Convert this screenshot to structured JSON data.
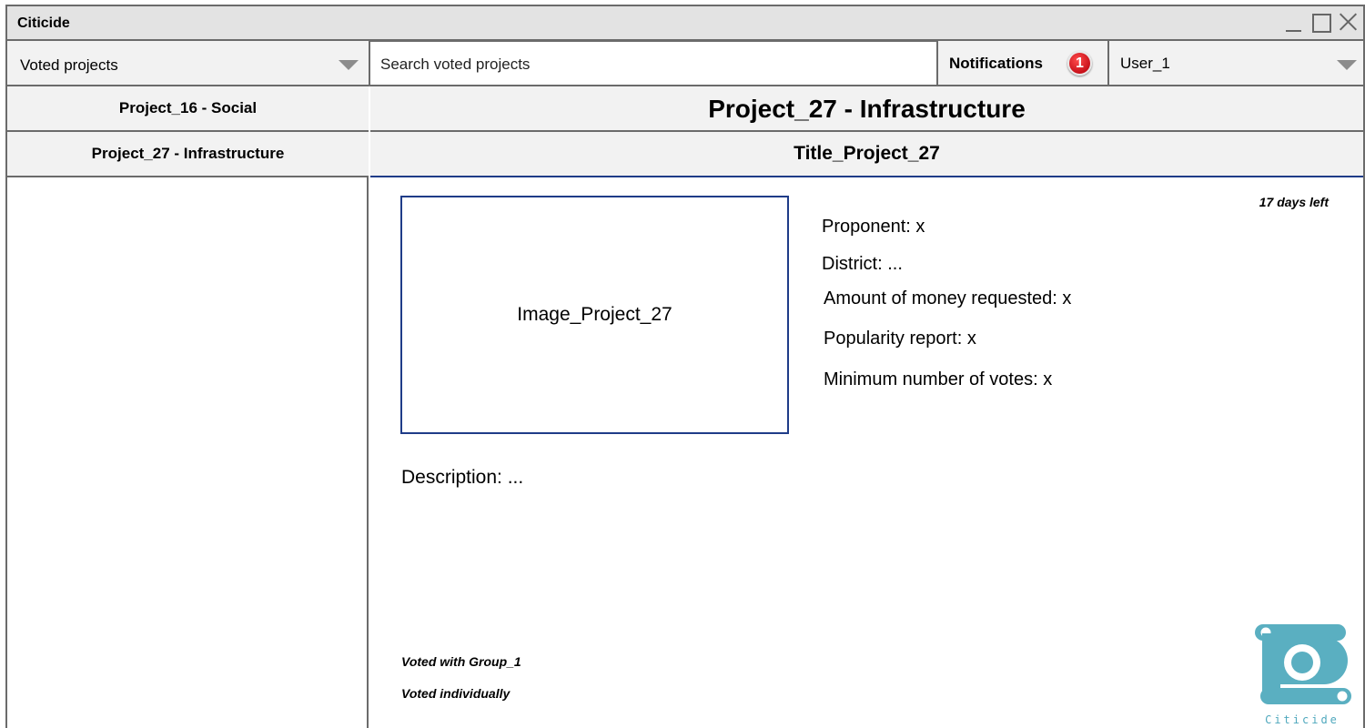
{
  "window": {
    "title": "Citicide",
    "controls": [
      "minimize-icon",
      "maximize-icon",
      "close-icon"
    ]
  },
  "toolbar": {
    "view_dropdown": {
      "selected": "Voted projects",
      "icon": "chevron-down-icon"
    },
    "search": {
      "placeholder": "Search voted projects"
    },
    "notifications": {
      "label": "Notifications",
      "count": "1"
    },
    "user_dropdown": {
      "selected": "User_1",
      "icon": "chevron-down-icon"
    }
  },
  "sidebar": {
    "items": [
      {
        "label": "Project_16 - Social"
      },
      {
        "label": "Project_27 - Infrastructure"
      }
    ]
  },
  "project": {
    "header": "Project_27 - Infrastructure",
    "title": "Title_Project_27",
    "image_label": "Image_Project_27",
    "days_left": "17 days left",
    "details": {
      "proponent": "Proponent: x",
      "district": "District: ...",
      "amount": "Amount of money requested: x",
      "popularity": "Popularity report: x",
      "min_votes": "Minimum number of votes: x"
    },
    "description": "Description: ...",
    "voted_group": "Voted with Group_1",
    "voted_individually": "Voted individually"
  },
  "logo": {
    "text": "Citicide",
    "color": "#5aafc1"
  },
  "colors": {
    "accent_border": "#1f3c88",
    "badge": "#d0121c",
    "panel_bg": "#f2f2f2"
  }
}
